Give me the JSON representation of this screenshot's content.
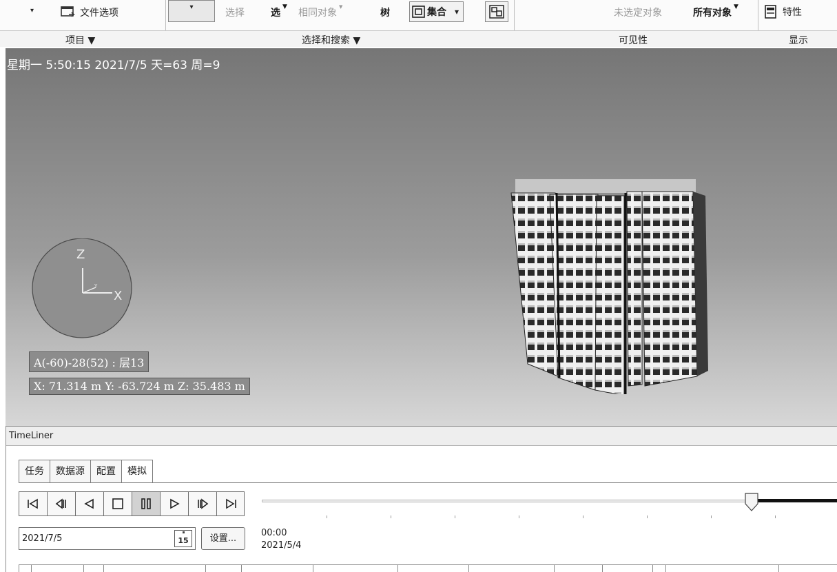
{
  "ribbon": {
    "project": {
      "caret": "▾",
      "file_options": "文件选项",
      "panel_label": "项目 ▼"
    },
    "select_search": {
      "select_dropdown": "▾",
      "select": "选择",
      "select2": "选",
      "same_objects": "相同对象",
      "tree": "树",
      "sets": "集合",
      "sets_caret": "▾",
      "panel_label": "选择和搜索 ▼"
    },
    "visibility": {
      "unselected": "未选定对象",
      "all_objects": "所有对象",
      "panel_label": "可见性"
    },
    "display": {
      "properties": "特性",
      "panel_label": "显示"
    }
  },
  "viewport": {
    "sim_status": "星期一 5:50:15 2021/7/5 天=63 周=9",
    "compass": {
      "z": "Z",
      "x": "X",
      "y": "Y"
    },
    "layer_info": "A(-60)-28(52) : 层13",
    "coords": "X: 71.314 m  Y: -63.724 m  Z: 35.483 m"
  },
  "timeliner": {
    "title": "TimeLiner",
    "tabs": [
      {
        "label": "任务",
        "active": false
      },
      {
        "label": "数据源",
        "active": false
      },
      {
        "label": "配置",
        "active": false
      },
      {
        "label": "模拟",
        "active": true
      }
    ],
    "controls": [
      "rewind-to-start",
      "step-back",
      "play-reverse",
      "stop",
      "pause",
      "play",
      "step-forward",
      "forward-to-end"
    ],
    "date_value": "2021/7/5",
    "calendar_number": "15",
    "settings_label": "设置...",
    "time_label": "00:00",
    "start_date": "2021/5/4",
    "slider_position": 0.85
  },
  "colors": {
    "viewport_top": "#767676",
    "viewport_bottom": "#d7d7d7",
    "building_dark": "#262626",
    "building_light": "#f2f2f2",
    "slider_fill": "#111111"
  }
}
